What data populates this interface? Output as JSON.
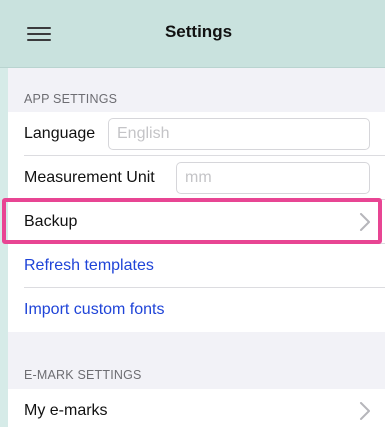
{
  "navbar": {
    "title": "Settings"
  },
  "app_settings": {
    "header": "APP SETTINGS",
    "language": {
      "label": "Language",
      "value": "",
      "placeholder": "English"
    },
    "measurement_unit": {
      "label": "Measurement Unit",
      "value": "",
      "placeholder": "mm"
    },
    "backup": {
      "label": "Backup"
    },
    "refresh_templates": {
      "label": "Refresh templates"
    },
    "import_fonts": {
      "label": "Import custom fonts"
    }
  },
  "emark_settings": {
    "header": "E-MARK SETTINGS",
    "my_emarks": {
      "label": "My e-marks"
    }
  },
  "colors": {
    "navbar_bg": "#c9e2de",
    "link": "#1f44d8",
    "highlight": "#e84593"
  },
  "icons": {
    "menu": "hamburger-menu-icon",
    "disclosure": "chevron-right-icon"
  }
}
